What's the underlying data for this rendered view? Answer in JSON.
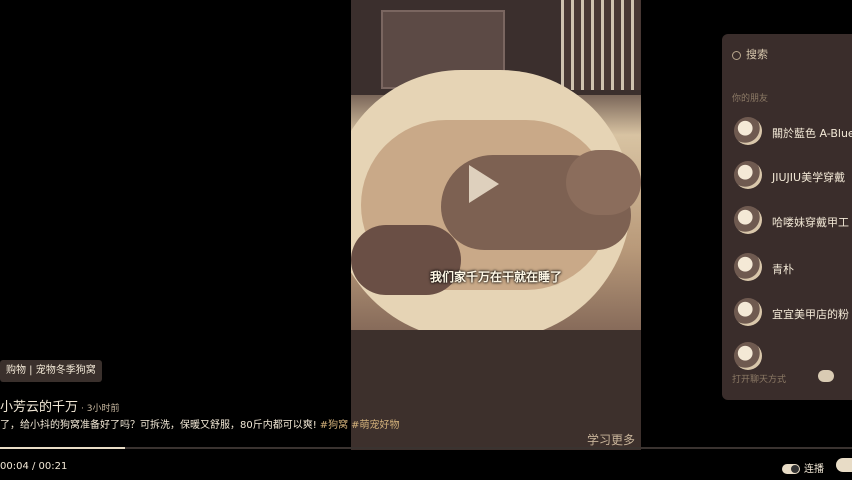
{
  "video": {
    "subtitle": "我们家千万在干就在睡了",
    "watermark": "学习更多"
  },
  "info": {
    "tags": "购物 | 宠物冬季狗窝",
    "author": "小芳云的千万",
    "time": "· 3小时前",
    "description": "了，给小抖的狗窝准备好了吗？可拆洗，保暖又舒服，80斤内都可以爽!",
    "hashtags": [
      "#狗窝",
      "#萌宠好物"
    ]
  },
  "player": {
    "timecode": "00:04 / 00:21",
    "progress": 0.19,
    "continuous_label": "连播"
  },
  "panel": {
    "search_label": "搜索",
    "section_title": "你的朋友",
    "items": [
      {
        "name": "關於藍色 A-Blue"
      },
      {
        "name": "JIUJIU美学穿戴"
      },
      {
        "name": "哈喽妹穿戴甲工"
      },
      {
        "name": "青朴"
      },
      {
        "name": "宜宜美甲店的粉"
      },
      {
        "name": ""
      }
    ],
    "footer": "打开聊天方式"
  },
  "colors": {
    "accent": "#e8dcc6",
    "tag": "#d2b07a",
    "panel_bg": "#3a2d2b"
  }
}
